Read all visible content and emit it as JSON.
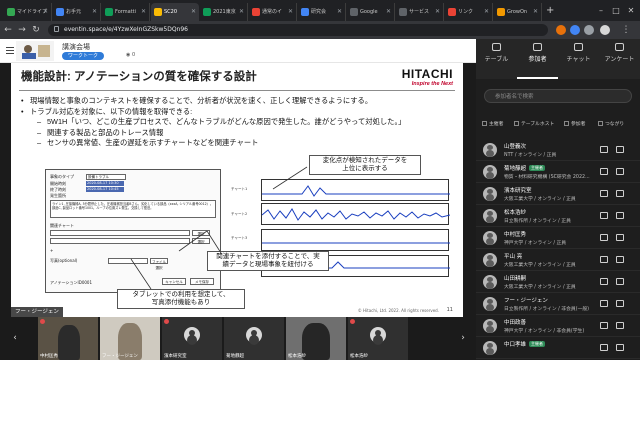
{
  "browser": {
    "tabs": [
      {
        "label": "マイドライブ",
        "color": "#34a853"
      },
      {
        "label": "お手元",
        "color": "#4285f4"
      },
      {
        "label": "Formatti",
        "color": "#0f9d58"
      },
      {
        "label": "SC20",
        "color": "#fbbc05"
      },
      {
        "label": "2021東京",
        "color": "#0f9d58"
      },
      {
        "label": "通常のイ",
        "color": "#ea4335"
      },
      {
        "label": "研究会",
        "color": "#4285f4"
      },
      {
        "label": "Google",
        "color": "#5f6368"
      },
      {
        "label": "サービス",
        "color": "#5f6368"
      },
      {
        "label": "リンク",
        "color": "#ea4335"
      },
      {
        "label": "GrowOn",
        "color": "#f29900"
      }
    ],
    "active_tab": 3,
    "url": "eventin.space/e/4YzwXeInGZSkw5DQn96",
    "new_tab": "+"
  },
  "event": {
    "room_name": "講演会場",
    "room_tag": "ワークトーク",
    "viewer_count": "0"
  },
  "slide": {
    "title": "機能設計: アノテーションの質を確保する設計",
    "brand_name": "HITACHI",
    "brand_tagline": "Inspire the Next",
    "bullets": [
      {
        "level": 1,
        "text": "現場情報と事象のコンテキストを確保することで、分析者が状況を速く、正しく理解できるようにする。"
      },
      {
        "level": 1,
        "text": "トラブル対応を対象に、以下の情報を取得できる:"
      },
      {
        "level": 2,
        "text": "5W1H「いつ、どこの生産プロセスで、どんなトラブルがどんな原因で発生した。誰がどうやって対処した。」"
      },
      {
        "level": 2,
        "text": "関連する製品と部品のトレース情報"
      },
      {
        "level": 2,
        "text": "センサの異常値、生産の遅延を示すチャートなどを関連チャート"
      }
    ],
    "form": {
      "rows": [
        "事象のタイプ",
        "開始時刻",
        "終了時刻",
        "発生箇所"
      ],
      "type_value": "設備トラブル",
      "start_value": "2020-08-17 10:30",
      "end_value": "2020-08-17 10:45",
      "description": "ライン1, 圧接機械A, 5分間停止した。圧着機械担当者Bさん。劣化している部品（xxxA, シリアル番号0012）。部品C, 製品ロット番号1001。ループの位置ズレ発生。交換して復旧。",
      "chart_section": "関連チャート",
      "photo_label": "写真(optional)",
      "select_btn": "選択",
      "upload_btn": "ファイル選択",
      "id_label": "アノテーションID0001",
      "cancel_btn": "キャンセル",
      "save_btn": "メモ保存"
    },
    "chart_labels": [
      "チャート1",
      "チャート2",
      "チャート3",
      "チャート4"
    ],
    "callout_top": [
      "変化点が検知されたデータを",
      "上位に表示する"
    ],
    "callout_mid": [
      "関連チャートを添付することで、実",
      "績データと現場事象を紐付ける"
    ],
    "callout_bottom": [
      "タブレットでの利用を想定して、",
      "写真添付機能もあり"
    ],
    "copyright": "© Hitachi, Ltd. 2022. All rights reserved.",
    "page_number": "11",
    "speaker": "フー・ジージェン"
  },
  "tiles": [
    {
      "name": "中村匡秀"
    },
    {
      "name": "フー・ジージェン"
    },
    {
      "name": "濱本研究室"
    },
    {
      "name": "菊地靜超"
    },
    {
      "name": "松本浩紗"
    }
  ],
  "sidebar": {
    "tabs": [
      "テーブル",
      "参加者",
      "チャット",
      "アンケート"
    ],
    "active_tab": 1,
    "search_placeholder": "参加者名で検索",
    "filters": [
      "主催者",
      "テーブルホスト",
      "参加者",
      "つながり"
    ],
    "participants": [
      {
        "name": "山登義次",
        "org": "NTT / オンライン / 正員",
        "badge": ""
      },
      {
        "name": "菊地靜超",
        "org": "物質・材料研究機構 (SC研究会 2022...",
        "badge": "主催者"
      },
      {
        "name": "濱本研究室",
        "org": "大阪工業大学 / オンライン / 正員",
        "badge": ""
      },
      {
        "name": "松本浩紗",
        "org": "日立製作所 / オンライン / 正員",
        "badge": ""
      },
      {
        "name": "中村匡秀",
        "org": "神戸大学 / オンライン / 正員",
        "badge": ""
      },
      {
        "name": "平山 亮",
        "org": "大阪工業大学 / オンライン / 正員",
        "badge": ""
      },
      {
        "name": "山田耕嗣",
        "org": "大阪工業大学 / オンライン / 正員",
        "badge": ""
      },
      {
        "name": "フー・ジージェン",
        "org": "日立製作所 / オンライン / 非会員(一般)",
        "badge": ""
      },
      {
        "name": "中田政善",
        "org": "神戸大学 / オンライン / 非会員(学生)",
        "badge": ""
      },
      {
        "name": "中口孝雄",
        "org": "",
        "badge": "主催者"
      }
    ]
  },
  "colors": {
    "chrome_dark": "#202124",
    "sidebar_bg": "#1e1e1e",
    "accent_blue": "#2f7bd8",
    "hitachi_red": "#c0002a"
  }
}
